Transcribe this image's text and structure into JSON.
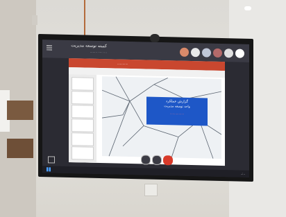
{
  "meeting": {
    "title": "کمیته توسعه مدیریت",
    "subtitle": "........ ..... ....",
    "participant_colors": [
      "#d98a6a",
      "#e8e8e8",
      "#c0c7d8",
      "#b46a6a",
      "#e0e0e0",
      "#ffffff"
    ]
  },
  "presentation": {
    "window_title": "............",
    "slide": {
      "line1": "گزارش عملکرد",
      "line2": "واحد توسعه مدیریت",
      "line3": "................",
      "accent_color": "#1e57c7"
    }
  },
  "taskbar": {
    "clock": "..:.."
  },
  "icons": {
    "menu": "hamburger-icon",
    "camera": "webcam-icon",
    "end_call": "end-call-icon",
    "fullscreen": "fullscreen-icon",
    "start": "windows-start-icon"
  }
}
